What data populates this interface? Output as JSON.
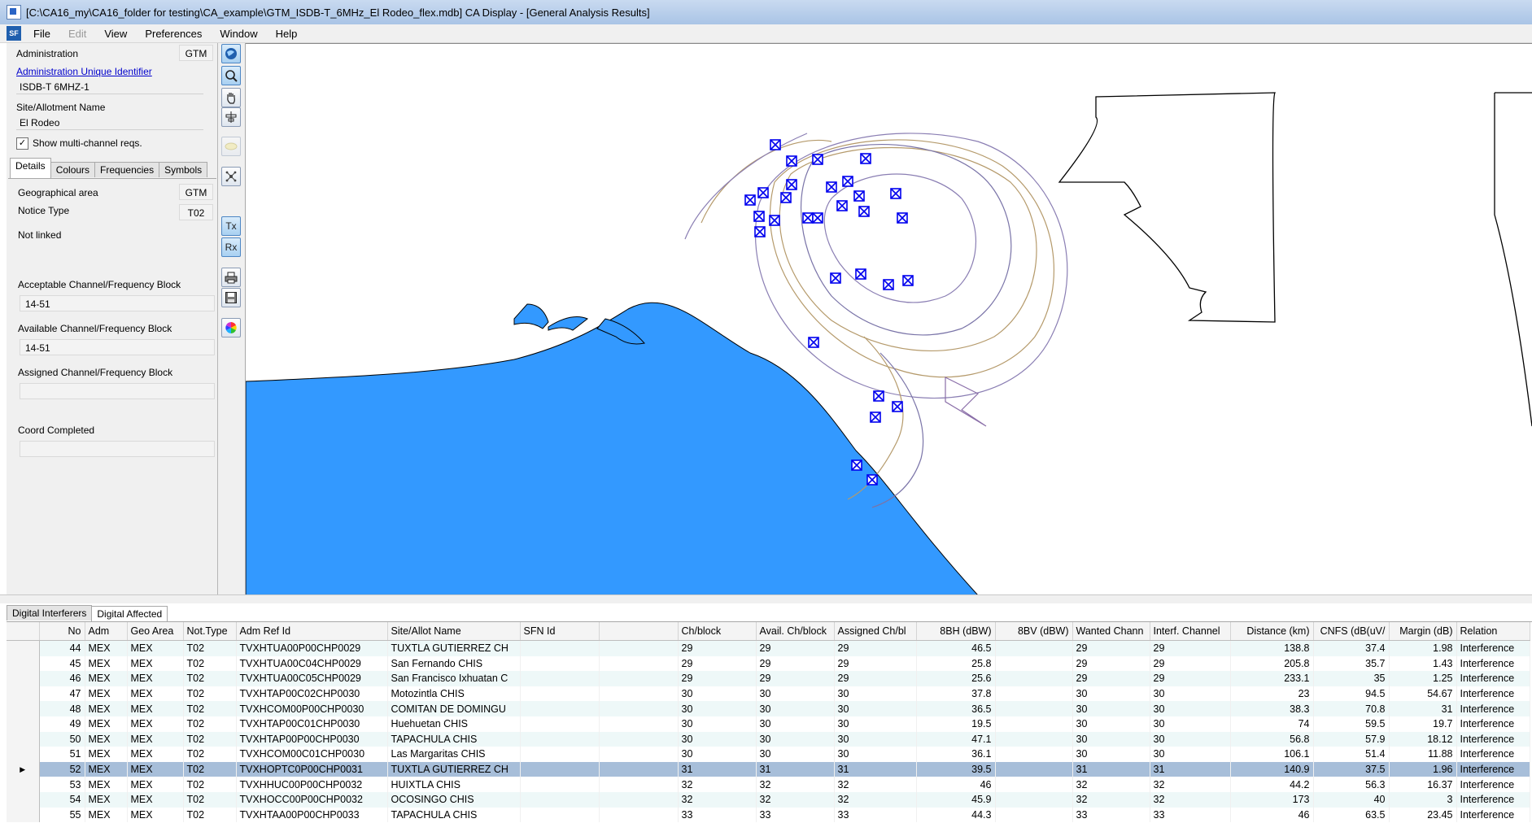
{
  "window": {
    "title": "[C:\\CA16_my\\CA16_folder for testing\\CA_example\\GTM_ISDB-T_6MHz_El Rodeo_flex.mdb] CA Display - [General Analysis Results]"
  },
  "menu": [
    "File",
    "Edit",
    "View",
    "Preferences",
    "Window",
    "Help"
  ],
  "menu_logo": "SF",
  "left_panel": {
    "administration_label": "Administration",
    "administration_value": "GTM",
    "admin_uid_link": "Administration Unique Identifier",
    "uid_value": "ISDB-T 6MHZ-1",
    "site_label": "Site/Allotment Name",
    "site_value": "El Rodeo",
    "show_multi_label": "Show multi-channel reqs.",
    "show_multi_checked": "✓",
    "tabs": [
      "Details",
      "Colours",
      "Frequencies",
      "Symbols"
    ],
    "details": {
      "geo_area_label": "Geographical area",
      "geo_area_value": "GTM",
      "notice_type_label": "Notice Type",
      "notice_type_value": "T02",
      "not_linked": "Not linked",
      "acceptable_label": "Acceptable Channel/Frequency Block",
      "acceptable_value": "14-51",
      "available_label": "Available Channel/Frequency Block",
      "available_value": "14-51",
      "assigned_label": "Assigned Channel/Frequency Block",
      "assigned_value": "",
      "coord_label": "Coord Completed",
      "coord_value": ""
    }
  },
  "toolbar": {
    "tx_label": "Tx",
    "rx_label": "Rx"
  },
  "bottom_tabs": [
    "Digital Interferers",
    "Digital Affected"
  ],
  "grid": {
    "columns": [
      "No",
      "Adm",
      "Geo Area",
      "Not.Type",
      "Adm Ref Id",
      "Site/Allot Name",
      "SFN Id",
      "",
      "Ch/block",
      "Avail. Ch/block",
      "Assigned Ch/bl",
      "8BH (dBW)",
      "8BV (dBW)",
      "Wanted Chann",
      "Interf. Channel",
      "Distance (km)",
      "CNFS (dB(uV/",
      "Margin (dB)",
      "Relation"
    ],
    "selected_marker": "▶",
    "rows": [
      [
        "44",
        "MEX",
        "MEX",
        "T02",
        "TVXHTUA00P00CHP0029",
        "TUXTLA GUTIERREZ CH",
        "",
        "",
        "29",
        "29",
        "29",
        "46.5",
        "",
        "29",
        "29",
        "138.8",
        "37.4",
        "1.98",
        "Interference"
      ],
      [
        "45",
        "MEX",
        "MEX",
        "T02",
        "TVXHTUA00C04CHP0029",
        "San Fernando CHIS",
        "",
        "",
        "29",
        "29",
        "29",
        "25.8",
        "",
        "29",
        "29",
        "205.8",
        "35.7",
        "1.43",
        "Interference"
      ],
      [
        "46",
        "MEX",
        "MEX",
        "T02",
        "TVXHTUA00C05CHP0029",
        "San Francisco Ixhuatan C",
        "",
        "",
        "29",
        "29",
        "29",
        "25.6",
        "",
        "29",
        "29",
        "233.1",
        "35",
        "1.25",
        "Interference"
      ],
      [
        "47",
        "MEX",
        "MEX",
        "T02",
        "TVXHTAP00C02CHP0030",
        "Motozintla CHIS",
        "",
        "",
        "30",
        "30",
        "30",
        "37.8",
        "",
        "30",
        "30",
        "23",
        "94.5",
        "54.67",
        "Interference"
      ],
      [
        "48",
        "MEX",
        "MEX",
        "T02",
        "TVXHCOM00P00CHP0030",
        "COMITAN DE DOMINGU",
        "",
        "",
        "30",
        "30",
        "30",
        "36.5",
        "",
        "30",
        "30",
        "38.3",
        "70.8",
        "31",
        "Interference"
      ],
      [
        "49",
        "MEX",
        "MEX",
        "T02",
        "TVXHTAP00C01CHP0030",
        "Huehuetan CHIS",
        "",
        "",
        "30",
        "30",
        "30",
        "19.5",
        "",
        "30",
        "30",
        "74",
        "59.5",
        "19.7",
        "Interference"
      ],
      [
        "50",
        "MEX",
        "MEX",
        "T02",
        "TVXHTAP00P00CHP0030",
        "TAPACHULA CHIS",
        "",
        "",
        "30",
        "30",
        "30",
        "47.1",
        "",
        "30",
        "30",
        "56.8",
        "57.9",
        "18.12",
        "Interference"
      ],
      [
        "51",
        "MEX",
        "MEX",
        "T02",
        "TVXHCOM00C01CHP0030",
        "Las Margaritas CHIS",
        "",
        "",
        "30",
        "30",
        "30",
        "36.1",
        "",
        "30",
        "30",
        "106.1",
        "51.4",
        "11.88",
        "Interference"
      ],
      [
        "52",
        "MEX",
        "MEX",
        "T02",
        "TVXHOPTC0P00CHP0031",
        "TUXTLA GUTIERREZ CH",
        "",
        "",
        "31",
        "31",
        "31",
        "39.5",
        "",
        "31",
        "31",
        "140.9",
        "37.5",
        "1.96",
        "Interference"
      ],
      [
        "53",
        "MEX",
        "MEX",
        "T02",
        "TVXHHUC00P00CHP0032",
        "HUIXTLA CHIS",
        "",
        "",
        "32",
        "32",
        "32",
        "46",
        "",
        "32",
        "32",
        "44.2",
        "56.3",
        "16.37",
        "Interference"
      ],
      [
        "54",
        "MEX",
        "MEX",
        "T02",
        "TVXHOCC00P00CHP0032",
        "OCOSINGO CHIS",
        "",
        "",
        "32",
        "32",
        "32",
        "45.9",
        "",
        "32",
        "32",
        "173",
        "40",
        "3",
        "Interference"
      ],
      [
        "55",
        "MEX",
        "MEX",
        "T02",
        "TVXHTAA00P00CHP0033",
        "TAPACHULA CHIS",
        "",
        "",
        "33",
        "33",
        "33",
        "44.3",
        "",
        "33",
        "33",
        "46",
        "63.5",
        "23.45",
        "Interference"
      ]
    ],
    "selected_index": 8
  },
  "map": {
    "sea_color": "#3399ff",
    "marker_color": "#0000ee"
  }
}
